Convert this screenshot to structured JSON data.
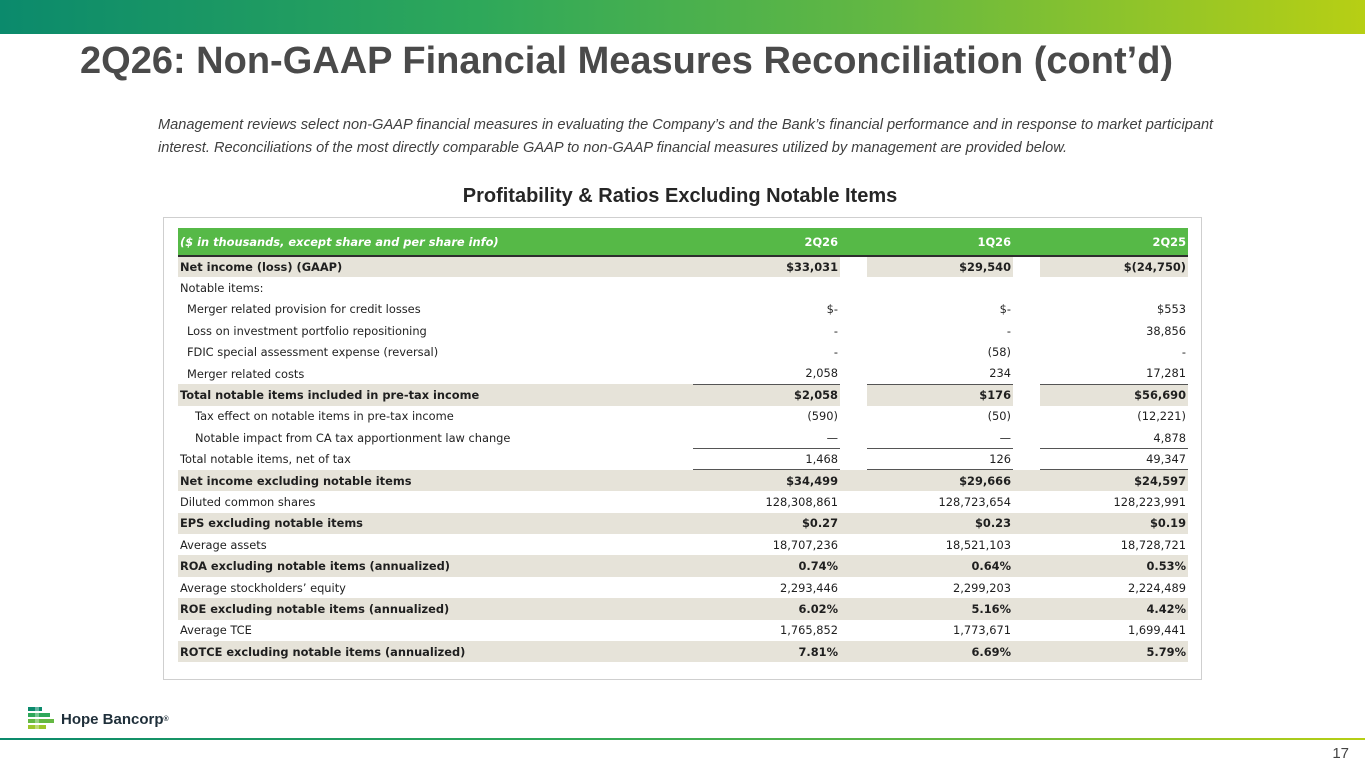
{
  "page": {
    "title": "2Q26: Non-GAAP Financial Measures Reconciliation (cont’d)",
    "intro": "Management reviews select non-GAAP financial measures in evaluating the Company’s and the Bank’s financial performance and in response to market participant interest. Reconciliations of the most directly comparable GAAP to non-GAAP financial measures utilized by management are provided below.",
    "page_number": "17"
  },
  "brand": {
    "name": "Hope Bancorp",
    "registered": "®",
    "primary_color": "#56b947",
    "dark_green": "#0b8a6c",
    "lime": "#b7cf14",
    "row_shade": "#e6e3d9"
  },
  "table": {
    "title": "Profitability & Ratios Excluding Notable Items",
    "header": {
      "label": "($ in thousands, except share and per share info)",
      "col1": "2Q26",
      "col2": "1Q26",
      "col3": "2Q25"
    },
    "rows": [
      {
        "label": "Net income (loss) (GAAP)",
        "v1": "$33,031",
        "v2": "$29,540",
        "v3": "$(24,750)"
      },
      {
        "label": "Notable items:",
        "v1": "",
        "v2": "",
        "v3": ""
      },
      {
        "label": "Merger related provision for credit losses",
        "v1": "$-",
        "v2": "$-",
        "v3": "$553"
      },
      {
        "label": "Loss on investment portfolio repositioning",
        "v1": "-",
        "v2": "-",
        "v3": "38,856"
      },
      {
        "label": "FDIC special assessment expense (reversal)",
        "v1": "-",
        "v2": "(58)",
        "v3": "-"
      },
      {
        "label": "Merger related costs",
        "v1": "2,058",
        "v2": "234",
        "v3": "17,281"
      },
      {
        "label": "Total notable items included in pre-tax income",
        "v1": "$2,058",
        "v2": "$176",
        "v3": "$56,690"
      },
      {
        "label": "Tax effect on notable items in pre-tax income",
        "v1": "(590)",
        "v2": "(50)",
        "v3": "(12,221)"
      },
      {
        "label": "Notable impact from CA tax apportionment law change",
        "v1": "—",
        "v2": "—",
        "v3": "4,878"
      },
      {
        "label": "Total notable items, net of tax",
        "v1": "1,468",
        "v2": "126",
        "v3": "49,347"
      },
      {
        "label": "Net income excluding notable items",
        "v1": "$34,499",
        "v2": "$29,666",
        "v3": "$24,597"
      },
      {
        "label": "Diluted common shares",
        "v1": "128,308,861",
        "v2": "128,723,654",
        "v3": "128,223,991"
      },
      {
        "label": "EPS excluding notable items",
        "v1": "$0.27",
        "v2": "$0.23",
        "v3": "$0.19"
      },
      {
        "label": "Average assets",
        "v1": "18,707,236",
        "v2": "18,521,103",
        "v3": "18,728,721"
      },
      {
        "label": "ROA excluding notable items (annualized)",
        "v1": "0.74%",
        "v2": "0.64%",
        "v3": "0.53%"
      },
      {
        "label": "Average stockholders’ equity",
        "v1": "2,293,446",
        "v2": "2,299,203",
        "v3": "2,224,489"
      },
      {
        "label": "ROE excluding notable items (annualized)",
        "v1": "6.02%",
        "v2": "5.16%",
        "v3": "4.42%"
      },
      {
        "label": "Average TCE",
        "v1": "1,765,852",
        "v2": "1,773,671",
        "v3": "1,699,441"
      },
      {
        "label": "ROTCE excluding notable items (annualized)",
        "v1": "7.81%",
        "v2": "6.69%",
        "v3": "5.79%"
      }
    ]
  }
}
